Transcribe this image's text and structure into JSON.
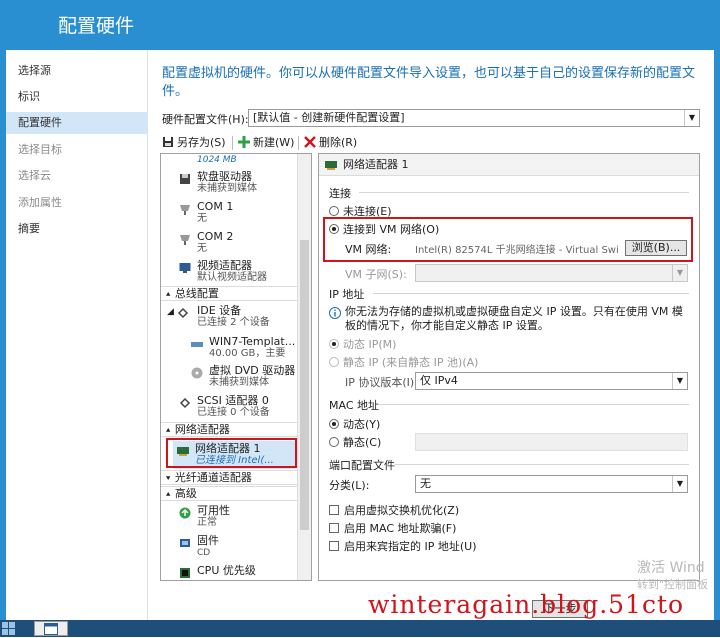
{
  "window": {
    "title": "配置硬件"
  },
  "nav": {
    "items": [
      {
        "label": "选择源",
        "state": "normal"
      },
      {
        "label": "标识",
        "state": "normal"
      },
      {
        "label": "配置硬件",
        "state": "active"
      },
      {
        "label": "选择目标",
        "state": "dim"
      },
      {
        "label": "选择云",
        "state": "dim"
      },
      {
        "label": "添加属性",
        "state": "dim"
      },
      {
        "label": "摘要",
        "state": "normal"
      }
    ]
  },
  "main": {
    "description": "配置虚拟机的硬件。你可以从硬件配置文件导入设置，也可以基于自己的设置保存新的配置文件。",
    "profile_label": "硬件配置文件(H):",
    "profile_value": "[默认值 - 创建新硬件配置设置]"
  },
  "toolbar": {
    "save_as": "另存为(S)",
    "new": "新建(W)",
    "delete": "删除(R)"
  },
  "tree": {
    "partial_top": "1024 MB",
    "floppy": {
      "name": "软盘驱动器",
      "sub": "未捕获到媒体"
    },
    "com1": {
      "name": "COM 1",
      "sub": "无"
    },
    "com2": {
      "name": "COM 2",
      "sub": "无"
    },
    "video": {
      "name": "视频适配器",
      "sub": "默认视频适配器"
    },
    "section_bus": "总线配置",
    "ide": {
      "name": "IDE 设备",
      "sub": "已连接 2 个设备"
    },
    "disk": {
      "name": "WIN7-Templat...",
      "sub": "40.00 GB，主要"
    },
    "dvd": {
      "name": "虚拟 DVD 驱动器",
      "sub": "未捕获到媒体"
    },
    "scsi": {
      "name": "SCSI 适配器 0",
      "sub": "已连接 0 个设备"
    },
    "section_network": "网络适配器",
    "nic": {
      "name": "网络适配器 1",
      "sub": "已连接到 Intel(..."
    },
    "section_fc": "光纤通道适配器",
    "section_advanced": "高级",
    "availability": {
      "name": "可用性",
      "sub": "正常"
    },
    "firmware": {
      "name": "固件",
      "sub": "CD"
    },
    "cpu_priority": {
      "name": "CPU 优先级"
    }
  },
  "detail": {
    "header": "网络适配器 1",
    "connection_group": "连接",
    "not_connected": "未连接(E)",
    "connect_vm_network": "连接到 VM 网络(O)",
    "vm_network_label": "VM 网络:",
    "vm_network_value": "Intel(R) 82574L 千兆网络连接 - Virtual Swi",
    "browse_button": "浏览(B)...",
    "vm_subnet_label": "VM 子网(S):",
    "ip_group": "IP 地址",
    "ip_info": "你无法为存储的虚拟机或虚拟硬盘自定义 IP 设置。只有在使用 VM 模板的情况下，你才能自定义静态 IP 设置。",
    "dynamic_ip": "动态 IP(M)",
    "static_ip": "静态 IP (来自静态 IP 池)(A)",
    "ip_version_label": "IP 协议版本(I):",
    "ip_version_value": "仅 IPv4",
    "mac_group": "MAC 地址",
    "mac_dynamic": "动态(Y)",
    "mac_static": "静态(C)",
    "port_group": "端口配置文件",
    "category_label": "分类(L):",
    "category_value": "无",
    "chk_vsw": "启用虚拟交换机优化(Z)",
    "chk_mac_spoof": "启用 MAC 地址欺骗(F)",
    "chk_guest_ip": "启用来宾指定的 IP 地址(U)"
  },
  "overlay": {
    "watermark": "winteragain.blog.51cto",
    "activate_title": "激活 Wind",
    "activate_sub": "转到\"控制面板"
  },
  "buttons": {
    "next": "下一步"
  },
  "colors": {
    "accent": "#2a8fd1",
    "highlight": "#d0141c",
    "link": "#1a6fb5"
  }
}
